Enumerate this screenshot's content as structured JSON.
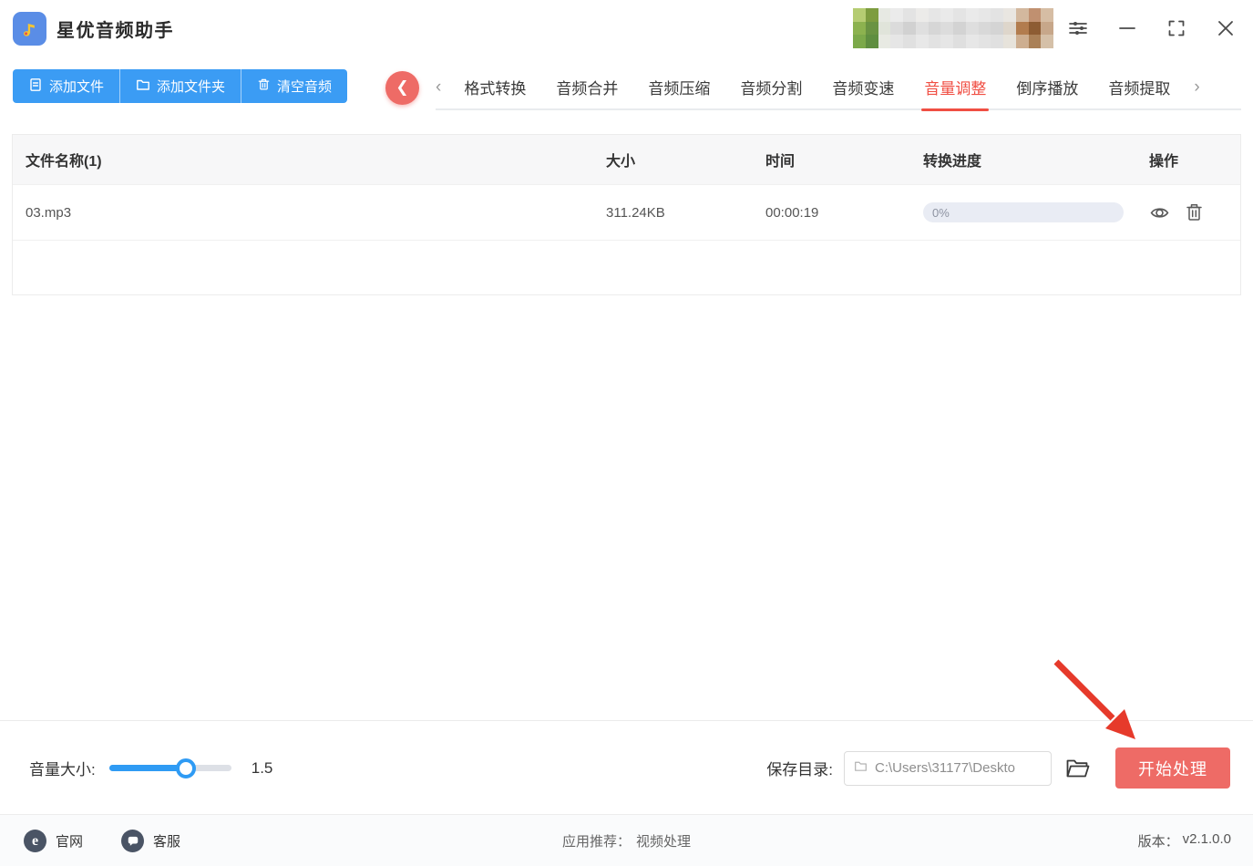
{
  "titlebar": {
    "app_title": "星优音频助手"
  },
  "toolbar": {
    "add_file": "添加文件",
    "add_folder": "添加文件夹",
    "clear_audio": "清空音频"
  },
  "tabs": {
    "items": [
      {
        "label": "格式转换",
        "active": false
      },
      {
        "label": "音频合并",
        "active": false
      },
      {
        "label": "音频压缩",
        "active": false
      },
      {
        "label": "音频分割",
        "active": false
      },
      {
        "label": "音频变速",
        "active": false
      },
      {
        "label": "音量调整",
        "active": true
      },
      {
        "label": "倒序播放",
        "active": false
      },
      {
        "label": "音频提取",
        "active": false
      }
    ]
  },
  "table": {
    "headers": {
      "name": "文件名称(1)",
      "size": "大小",
      "time": "时间",
      "progress": "转换进度",
      "actions": "操作"
    },
    "rows": [
      {
        "name": "03.mp3",
        "size": "311.24KB",
        "time": "00:00:19",
        "progress": "0%"
      }
    ]
  },
  "bottom": {
    "volume_label": "音量大小:",
    "volume_value": "1.5",
    "volume_percent": 63,
    "save_dir_label": "保存目录:",
    "save_dir_path": "C:\\Users\\31177\\Deskto",
    "start_button": "开始处理"
  },
  "footer": {
    "website": "官网",
    "support": "客服",
    "recommend_label": "应用推荐：",
    "recommend_link": "视频处理",
    "version_label": "版本：",
    "version": "v2.1.0.0"
  },
  "colors": {
    "toolbar_blue": "#3b9cf4",
    "active_tab_red": "#f04e43",
    "salmon_button": "#ee6b66",
    "arrow_red": "#e63a2b",
    "slider_blue": "#2f9bf4",
    "progress_pill_bg": "#e9ecf4"
  },
  "blur_mosaic": {
    "rows": [
      [
        "#b5cc72",
        "#7d9c3f",
        "#e7e9e3",
        "#ebebeb",
        "#e3e3e3",
        "#ecebe9",
        "#e6e6e6",
        "#eaeaea",
        "#e4e4e4",
        "#eaeaea",
        "#e7e7e7",
        "#e3e3e3",
        "#e9e6e1",
        "#d3b89e",
        "#c09070",
        "#d6bda4"
      ],
      [
        "#8cb24f",
        "#6a9342",
        "#e0e4da",
        "#dbdbdb",
        "#d1d1d1",
        "#dfdfdf",
        "#d6d6d6",
        "#dcdcdc",
        "#d3d3d3",
        "#dedede",
        "#d8d8d8",
        "#d4d4d4",
        "#ded6cb",
        "#b27c4e",
        "#8d5c33",
        "#c7a78a"
      ],
      [
        "#7ca94a",
        "#5f8e40",
        "#e8eae3",
        "#e6e6e6",
        "#e0e0e0",
        "#e8e8e8",
        "#e2e2e2",
        "#e6e6e6",
        "#dfdfdf",
        "#e7e7e7",
        "#e3e3e3",
        "#e0e0e0",
        "#e7e3db",
        "#cdae90",
        "#aa8057",
        "#d5c0a8"
      ]
    ]
  }
}
